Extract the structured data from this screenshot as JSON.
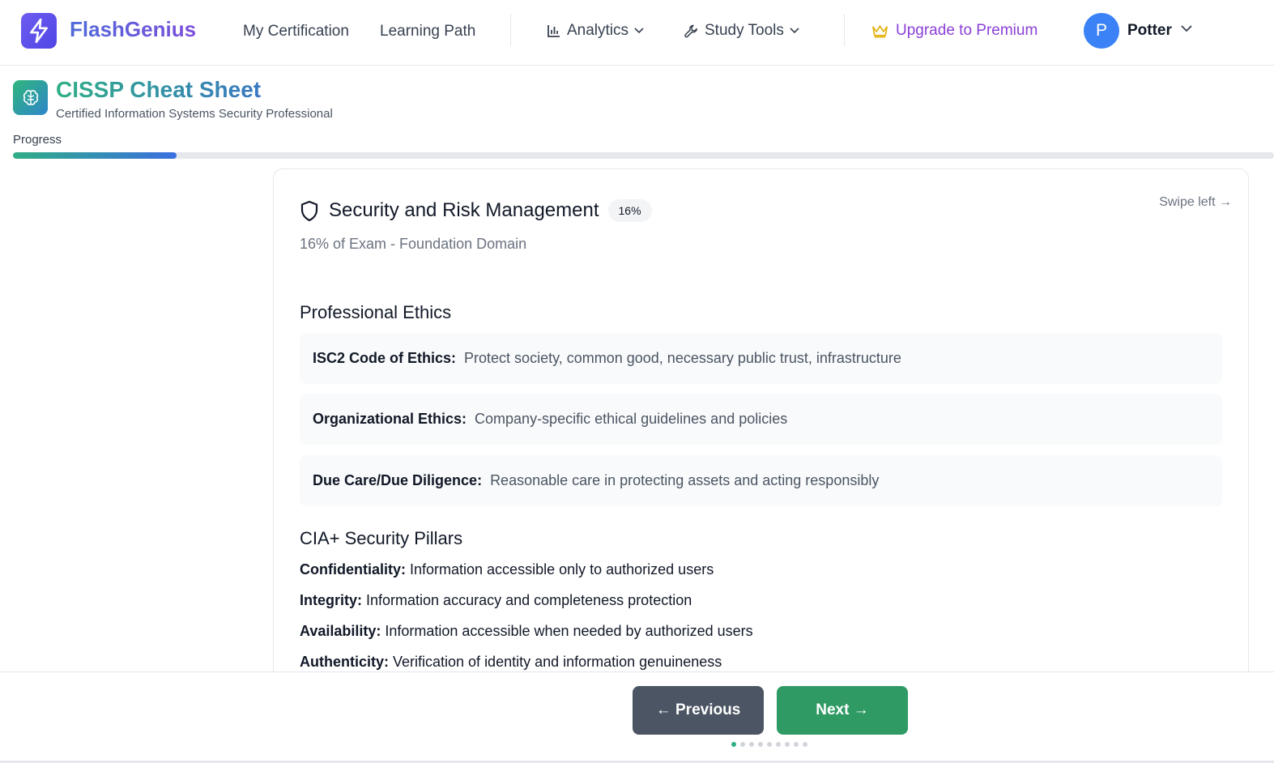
{
  "header": {
    "brand": "FlashGenius",
    "nav": [
      "My Certification",
      "Learning Path"
    ],
    "dropdowns": {
      "analytics": "Analytics",
      "study_tools": "Study Tools"
    },
    "premium": "Upgrade to Premium",
    "user": {
      "initial": "P",
      "name": "Potter"
    }
  },
  "sheet": {
    "title": "CISSP Cheat Sheet",
    "subtitle": "Certified Information Systems Security Professional",
    "progress_label": "Progress",
    "progress_fraction": 0.13
  },
  "card": {
    "domain_title": "Security and Risk Management",
    "badge": "16%",
    "swipe_hint": "Swipe left →",
    "domain_subtitle": "16% of Exam - Foundation Domain",
    "sections": [
      {
        "title": "Professional Ethics",
        "items": [
          {
            "term": "ISC2 Code of Ethics:",
            "def": "Protect society, common good, necessary public trust, infrastructure"
          },
          {
            "term": "Organizational Ethics:",
            "def": "Company-specific ethical guidelines and policies"
          },
          {
            "term": "Due Care/Due Diligence:",
            "def": "Reasonable care in protecting assets and acting responsibly"
          }
        ]
      },
      {
        "title": "CIA+ Security Pillars",
        "items": [
          {
            "term": "Confidentiality:",
            "def": "Information accessible only to authorized users"
          },
          {
            "term": "Integrity:",
            "def": "Information accuracy and completeness protection"
          },
          {
            "term": "Availability:",
            "def": "Information accessible when needed by authorized users"
          },
          {
            "term": "Authenticity:",
            "def": "Verification of identity and information genuineness"
          }
        ]
      }
    ]
  },
  "footer": {
    "prev_label": "← Previous",
    "next_label": "Next →",
    "page_count": 9,
    "current_page": 1
  },
  "colors": {
    "brand": "#4f46e5",
    "premium": "#8b3fd6",
    "next_button": "#2f9a64",
    "prev_button": "#4b5563",
    "avatar": "#3b82f6"
  },
  "icons": {
    "logo": "lightning-icon",
    "analytics": "bar-chart-icon",
    "study_tools": "wrench-icon",
    "premium": "crown-icon",
    "sheet": "brain-icon",
    "domain": "shield-icon"
  }
}
